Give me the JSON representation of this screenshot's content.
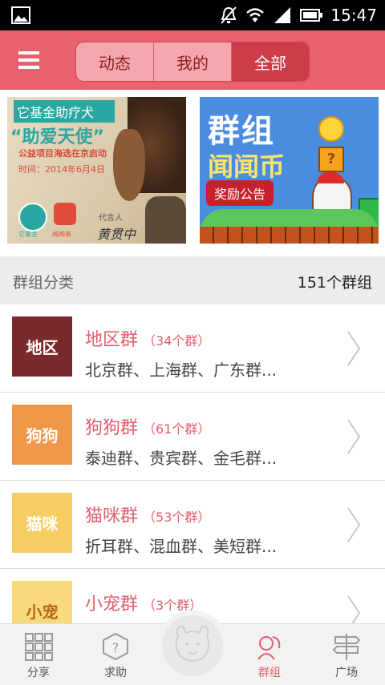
{
  "status_bar": {
    "time": "15:47"
  },
  "header": {
    "tabs": [
      {
        "label": "动态",
        "active": false
      },
      {
        "label": "我的",
        "active": false
      },
      {
        "label": "全部",
        "active": true
      }
    ]
  },
  "banners": {
    "left": {
      "line1": "它基金助疗犬",
      "line2": "“助爱天使”",
      "line3": "公益项目海选在京启动",
      "line4": "时间：2014年6月4日",
      "logo1": "它基金",
      "logo2": "闻闻茶",
      "spokesman_label": "代言人",
      "spokesman_name": "黄贯中"
    },
    "right": {
      "title1": "群组",
      "title2": "闻闻币",
      "badge": "奖励公告"
    }
  },
  "category": {
    "title": "群组分类",
    "total": "151个群组"
  },
  "groups": [
    {
      "thumb": "地区",
      "thumb_color": "#7a2a2c",
      "name": "地区群",
      "count": "（34个群）",
      "sub": "北京群、上海群、广东群..."
    },
    {
      "thumb": "狗狗",
      "thumb_color": "#f0984a",
      "name": "狗狗群",
      "count": "（61个群）",
      "sub": "泰迪群、贵宾群、金毛群..."
    },
    {
      "thumb": "猫咪",
      "thumb_color": "#f6cd62",
      "name": "猫咪群",
      "count": "（53个群）",
      "sub": "折耳群、混血群、美短群..."
    },
    {
      "thumb": "小宠",
      "thumb_color": "#f8da7a",
      "name": "小宠群",
      "count": "（3个群）",
      "sub": ""
    }
  ],
  "tabbar": {
    "items": [
      {
        "label": "分享",
        "icon": "grid-icon"
      },
      {
        "label": "求助",
        "icon": "help-box-icon"
      },
      {
        "label": "群组",
        "icon": "group-icon",
        "active": true
      },
      {
        "label": "广场",
        "icon": "signpost-icon"
      }
    ]
  },
  "colors": {
    "accent": "#e8616d",
    "active_tab": "#cf3c49",
    "list_text": "#e25e6c"
  }
}
